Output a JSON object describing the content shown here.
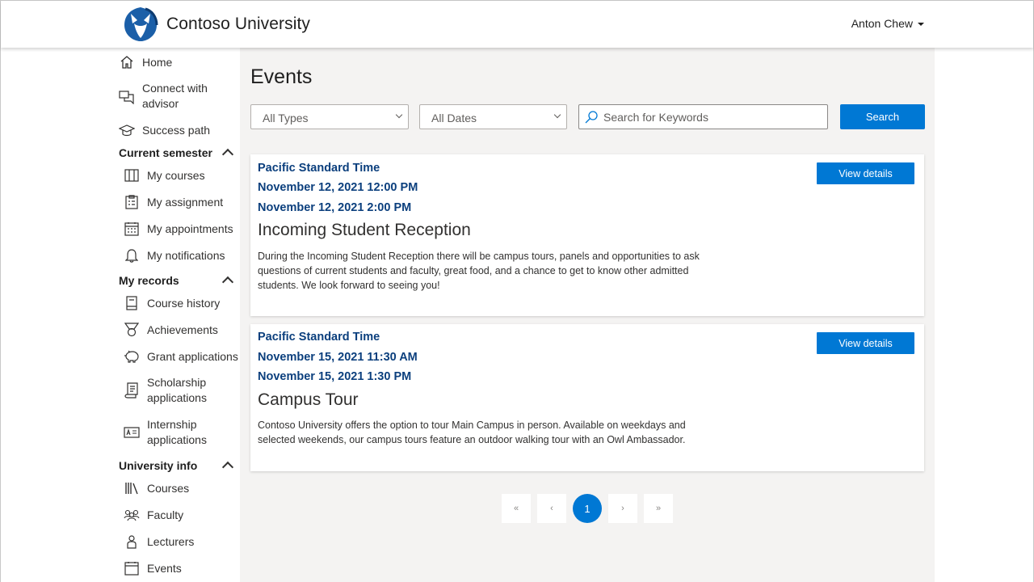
{
  "app": {
    "brand": "Contoso University",
    "user_name": "Anton Chew"
  },
  "sidebar": {
    "top_items": [
      {
        "label": "Home",
        "icon": "home-icon"
      },
      {
        "label": "Connect with\nadvisor",
        "icon": "chat-icon"
      },
      {
        "label": "Success path",
        "icon": "graduation-cap-icon"
      }
    ],
    "sections": [
      {
        "title": "Current semester",
        "items": [
          {
            "label": "My courses",
            "icon": "book-open-icon"
          },
          {
            "label": "My assignment",
            "icon": "clipboard-icon"
          },
          {
            "label": "My appointments",
            "icon": "calendar-icon"
          },
          {
            "label": "My notifications",
            "icon": "bell-icon"
          }
        ]
      },
      {
        "title": "My records",
        "items": [
          {
            "label": "Course history",
            "icon": "notebook-icon"
          },
          {
            "label": "Achievements",
            "icon": "medal-icon"
          },
          {
            "label": "Grant applications",
            "icon": "piggy-bank-icon"
          },
          {
            "label": "Scholarship\napplications",
            "icon": "certificate-icon"
          },
          {
            "label": "Internship\napplications",
            "icon": "id-card-icon"
          }
        ]
      },
      {
        "title": "University info",
        "items": [
          {
            "label": "Courses",
            "icon": "library-icon"
          },
          {
            "label": "Faculty",
            "icon": "people-icon"
          },
          {
            "label": "Lecturers",
            "icon": "person-icon"
          },
          {
            "label": "Events",
            "icon": "calendar-icon"
          }
        ]
      }
    ]
  },
  "main": {
    "page_title": "Events",
    "filters": {
      "type_selected": "All Types",
      "date_selected": "All Dates",
      "search_placeholder": "Search for Keywords",
      "search_button": "Search"
    },
    "events": [
      {
        "timezone": "Pacific Standard Time",
        "start": "November 12, 2021 12:00 PM",
        "end": "November 12, 2021 2:00 PM",
        "title": "Incoming Student Reception",
        "description": "During the Incoming Student Reception there will be campus tours, panels and opportunities to ask questions of current students and faculty, great food, and a chance to get to know other admitted students. We look forward to seeing you!",
        "button": "View details"
      },
      {
        "timezone": "Pacific Standard Time",
        "start": "November 15, 2021 11:30 AM",
        "end": "November 15, 2021 1:30 PM",
        "title": "Campus Tour",
        "description": "Contoso University offers the option to tour Main Campus in person. Available on weekdays and selected weekends, our campus tours feature an outdoor walking tour with an Owl Ambassador.",
        "button": "View details"
      }
    ],
    "pagination": {
      "first": "«",
      "prev": "‹",
      "current": "1",
      "next": "›",
      "last": "»"
    }
  },
  "colors": {
    "accent": "#0078d4",
    "event_heading": "#0b3f7d",
    "main_bg": "#f4f3f2"
  }
}
